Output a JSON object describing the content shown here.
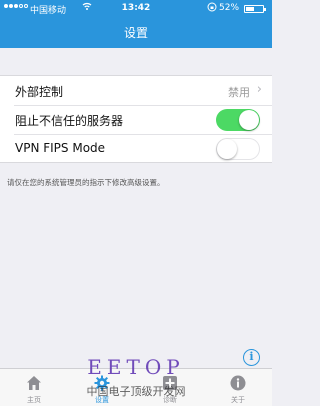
{
  "status_bar": {
    "carrier": "中国移动",
    "time": "13:42",
    "battery_percent": "52%",
    "battery_level": 0.52,
    "icons": [
      "signal-dots-icon",
      "wifi-icon",
      "orientation-lock-icon",
      "battery-icon"
    ]
  },
  "nav": {
    "title": "设置"
  },
  "settings": {
    "items": [
      {
        "label": "外部控制",
        "value": "禁用"
      },
      {
        "label": "阻止不信任的服务器",
        "toggle": true
      },
      {
        "label": "VPN FIPS Mode",
        "toggle": false
      }
    ]
  },
  "note": "请仅在您的系统管理员的指示下修改高级设置。",
  "tabs": [
    {
      "label": "主页",
      "icon": "home-icon"
    },
    {
      "label": "设置",
      "icon": "gear-icon",
      "active": true
    },
    {
      "label": "诊断",
      "icon": "diagnostics-icon"
    },
    {
      "label": "关于",
      "icon": "info-icon"
    }
  ],
  "watermark": {
    "title": "EETOP",
    "subtitle": "中国电子顶级开发网"
  },
  "colors": {
    "accent": "#2a95dc",
    "toggle_on": "#4cd964",
    "background": "#efeff4"
  }
}
